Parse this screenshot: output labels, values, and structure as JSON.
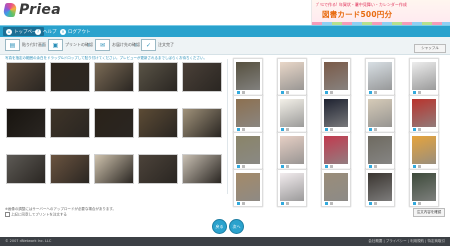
{
  "header": {
    "logo_text": "Priea"
  },
  "banner": {
    "line1": "ﾌﾟﾘｴで作る! 年賀状・暑中見舞い・カレンダー作成",
    "line2": "図書カード500円分"
  },
  "toolbar": {
    "items": [
      {
        "label": "トップページ",
        "icon": "home-icon"
      },
      {
        "label": "ヘルプ",
        "icon": "help-icon"
      },
      {
        "label": "ログアウト",
        "icon": "logout-icon"
      }
    ]
  },
  "actions": {
    "steps": [
      {
        "label": "貼り付け画面",
        "icon": "step-select"
      },
      {
        "label": "プリントの確認",
        "icon": "step-confirm"
      },
      {
        "label": "お届け先の確認",
        "icon": "step-address"
      },
      {
        "label": "注文完了",
        "icon": "step-done"
      }
    ],
    "shuffle": "シャッフル"
  },
  "notice": "写真を指定の範囲の余白をドラッグ&ドロップして貼り付けてください。プレビューが更新されるまでしばらくお待ちください。",
  "photos": [
    {
      "color": "#5b4a3a"
    },
    {
      "color": "#2f261d"
    },
    {
      "color": "#7a6a55"
    },
    {
      "color": "#595346"
    },
    {
      "color": "#4a4038"
    },
    {
      "color": "#18140f"
    },
    {
      "color": "#3e3428"
    },
    {
      "color": "#2a2219"
    },
    {
      "color": "#5c4b35"
    },
    {
      "color": "#a0927a"
    },
    {
      "color": "#5d5a55"
    },
    {
      "color": "#6b5440"
    },
    {
      "color": "#cfc3ae"
    },
    {
      "color": "#4c433a"
    },
    {
      "color": "#c9c0b3"
    }
  ],
  "prints": [
    {
      "color": "#56503f"
    },
    {
      "color": "#e9d7c8"
    },
    {
      "color": "#7a5a48"
    },
    {
      "color": "#d8dfe4"
    },
    {
      "color": "#ededed"
    },
    {
      "color": "#8c7050"
    },
    {
      "color": "#f3f0e8"
    },
    {
      "color": "#1e2230"
    },
    {
      "color": "#d6cbb8"
    },
    {
      "color": "#b9332c"
    },
    {
      "color": "#8a8468"
    },
    {
      "color": "#e6cfc4"
    },
    {
      "color": "#c23a4e"
    },
    {
      "color": "#6e6a60"
    },
    {
      "color": "#e6a43c"
    },
    {
      "color": "#a48a68"
    },
    {
      "color": "#f2ecee"
    },
    {
      "color": "#9a8d79"
    },
    {
      "color": "#3a3530"
    },
    {
      "color": "#3d4a3a"
    }
  ],
  "footer": {
    "line1": "※画像の調整にはサーバーへのアップロードが必要な場合があります。",
    "line2": "上記に同意してプリントを注文する",
    "next": "注文内容を確認",
    "round1": "戻る",
    "round2": "次へ"
  },
  "bottombar": {
    "copyright": "© 2007 dNetwork Inc. LLC",
    "links": "会社概要 | プライバシー | 利用規約 | 特定商取引"
  }
}
